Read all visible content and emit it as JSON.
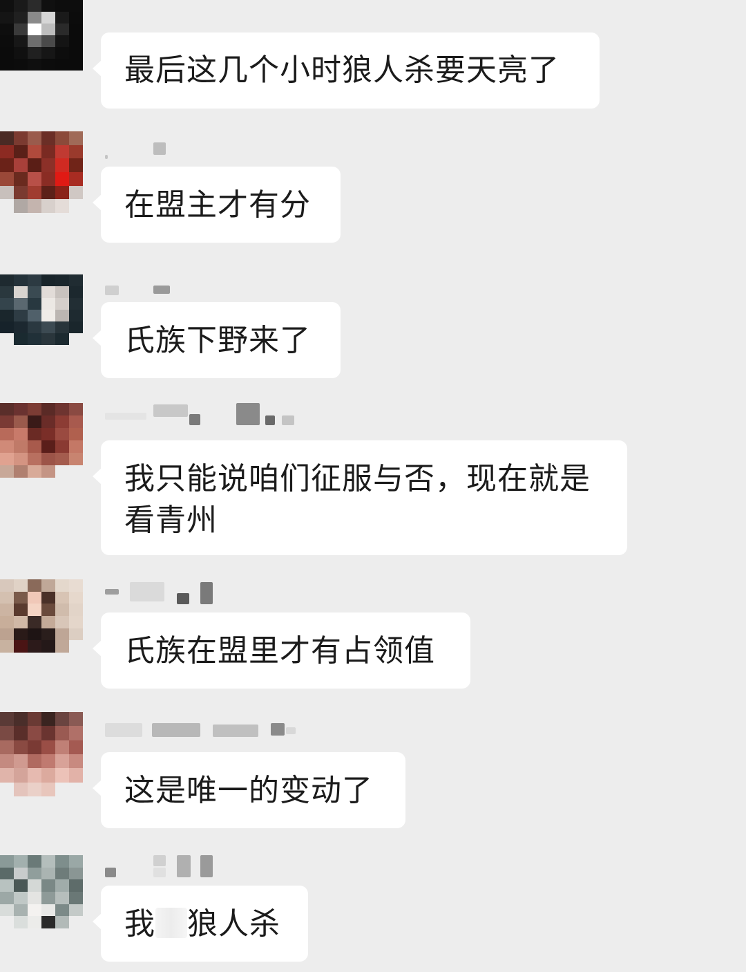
{
  "chat": {
    "messages": [
      {
        "text": "最后这几个小时狼人杀要天亮了",
        "avatar": {
          "colors": [
            "#101010",
            "#1a1a1a",
            "#2b2b2b",
            "#101010",
            "#0d0d0d",
            "#0d0d0d",
            "#151515",
            "#202020",
            "#8a8a8a",
            "#d6d6d6",
            "#1a1a1a",
            "#0c0c0c",
            "#0e0e0e",
            "#3a3a3a",
            "#ffffff",
            "#bdbdbd",
            "#2a2a2a",
            "#0b0b0b",
            "#0c0c0c",
            "#171717",
            "#6e6e6e",
            "#4a4a4a",
            "#141414",
            "#0b0b0b",
            "#0b0b0b",
            "#101010",
            "#202020",
            "#161616",
            "#0d0d0d",
            "#0b0b0b",
            "#0b0b0b",
            "#0c0c0c",
            "#0f0f0f",
            "#0c0c0c",
            "#0b0b0b",
            "#0b0b0b"
          ]
        }
      },
      {
        "text": "在盟主才有分",
        "avatar": {
          "colors": [
            "#4a2a24",
            "#7b3a30",
            "#9a5b4c",
            "#6b2e26",
            "#8b4a3a",
            "#a06a58",
            "#8c2a22",
            "#5a2018",
            "#b04a3c",
            "#7a2a22",
            "#c03a32",
            "#9a3a2c",
            "#6a2218",
            "#a8403a",
            "#5a1e16",
            "#8c3028",
            "#d02a22",
            "#702418",
            "#9a4838",
            "#6a2a1e",
            "#b85048",
            "#8a2c24",
            "#e01a14",
            "#a82c22",
            "#c8c0bc",
            "#7a3a30",
            "#a03c30",
            "#5c2018",
            "#8a2218",
            "#d0c8c4",
            "#ededed",
            "#b0a8a4",
            "#c4b4ae",
            "#d8d0cc",
            "#e4dcd8",
            "#ededed"
          ]
        }
      },
      {
        "text": "氏族下野来了",
        "avatar": {
          "colors": [
            "#1e2a30",
            "#24323a",
            "#2c3a42",
            "#18242a",
            "#1a262c",
            "#202c32",
            "#2a383e",
            "#d8d4d0",
            "#3a4a52",
            "#e2dcd8",
            "#c8c2be",
            "#1c282e",
            "#34444c",
            "#5a6870",
            "#283840",
            "#ece8e4",
            "#d4ceca",
            "#222e34",
            "#1a262c",
            "#2e3c44",
            "#50606a",
            "#f0ece8",
            "#bcb6b2",
            "#1e2a30",
            "#16222a",
            "#1c2830",
            "#2a3840",
            "#3c4a52",
            "#28343a",
            "#1a262c",
            "#ededed",
            "#1a2a30",
            "#203038",
            "#2a363c",
            "#1c2a30",
            "#ededed"
          ]
        }
      },
      {
        "text": "我只能说咱们征服与否，现在就是看青州",
        "lines": [
          "我只能说咱们征服与否，现在就是",
          "看青州"
        ],
        "avatar": {
          "colors": [
            "#5a2e2a",
            "#6a3230",
            "#7c3c34",
            "#5a2a26",
            "#6e3430",
            "#8a4a42",
            "#7a3a34",
            "#9a5a4c",
            "#3a1a18",
            "#6a2c28",
            "#8c3c34",
            "#a85a4e",
            "#b86a5a",
            "#c87a6a",
            "#6a2a24",
            "#7a2e28",
            "#9a4a40",
            "#b0604e",
            "#d08a78",
            "#c07a68",
            "#a85a4c",
            "#5a1e1a",
            "#8a3a32",
            "#c47866",
            "#e0a290",
            "#d49482",
            "#b87060",
            "#9c5448",
            "#a45c4e",
            "#c88470",
            "#c8a898",
            "#b08070",
            "#d8aa98",
            "#c49484",
            "#ededed",
            "#ededed"
          ]
        }
      },
      {
        "text": "氏族在盟里才有占领值",
        "avatar": {
          "colors": [
            "#d8c8bc",
            "#e0d2c6",
            "#8a6a5a",
            "#c0a898",
            "#e4d8cc",
            "#e8dcd2",
            "#d4c0b0",
            "#7a5a4a",
            "#f0c8b8",
            "#4a3028",
            "#d8c4b4",
            "#e6d8cc",
            "#ccb4a2",
            "#5a3a2e",
            "#f4d4c4",
            "#6a4a3c",
            "#d0bcac",
            "#e2d4c8",
            "#c8ae9a",
            "#d0b8a6",
            "#3a2a26",
            "#c4aa98",
            "#d8c6b8",
            "#e4d6ca",
            "#bca290",
            "#2a1a18",
            "#1e1414",
            "#2a1e1c",
            "#bea696",
            "#dccec2",
            "#c8b2a0",
            "#4a1414",
            "#2c1a1a",
            "#241818",
            "#c0a898",
            "#ededed"
          ]
        }
      },
      {
        "text": "这是唯一的变动了",
        "avatar": {
          "colors": [
            "#5a3a36",
            "#4a2e2a",
            "#6a3a34",
            "#3a2420",
            "#6a4440",
            "#8a5a54",
            "#7a4a44",
            "#5a2e2a",
            "#8a4a44",
            "#6a3430",
            "#9a5a52",
            "#b07068",
            "#a86a60",
            "#8a4a42",
            "#7a3a34",
            "#9a4e46",
            "#c08076",
            "#a45a52",
            "#c48a80",
            "#d09a90",
            "#b06a60",
            "#c07a70",
            "#d8a298",
            "#c88a80",
            "#e0b4aa",
            "#d4a49a",
            "#e6bab0",
            "#dcaa9e",
            "#ecc2b8",
            "#e2b2a8",
            "#ededed",
            "#e4c4bc",
            "#ead0c8",
            "#e8c6bc",
            "#ededed",
            "#ededed"
          ]
        }
      },
      {
        "text": "我要玩狼人杀",
        "display": {
          "pre": "我",
          "post": "狼人杀"
        },
        "avatar": {
          "colors": [
            "#8a9a98",
            "#a2b0ae",
            "#6a7a78",
            "#b4bebc",
            "#7e8e8c",
            "#9aa8a6",
            "#5a6a68",
            "#c8cccc",
            "#909e9c",
            "#aab4b2",
            "#6e7c7a",
            "#8a9694",
            "#b8c2c0",
            "#4a5856",
            "#d4d8d6",
            "#7a8886",
            "#a0acaa",
            "#5e6c6a",
            "#9ca8a6",
            "#c0c8c6",
            "#e4e4e2",
            "#8e9a98",
            "#b6bebc",
            "#6a7876",
            "#d8dcda",
            "#a8b2b0",
            "#f4f2f0",
            "#e8e8e6",
            "#7c8a88",
            "#c4cac8",
            "#ededed",
            "#dadedc",
            "#ececea",
            "#2a2a2a",
            "#b2bab8",
            "#ededed"
          ]
        }
      }
    ]
  }
}
